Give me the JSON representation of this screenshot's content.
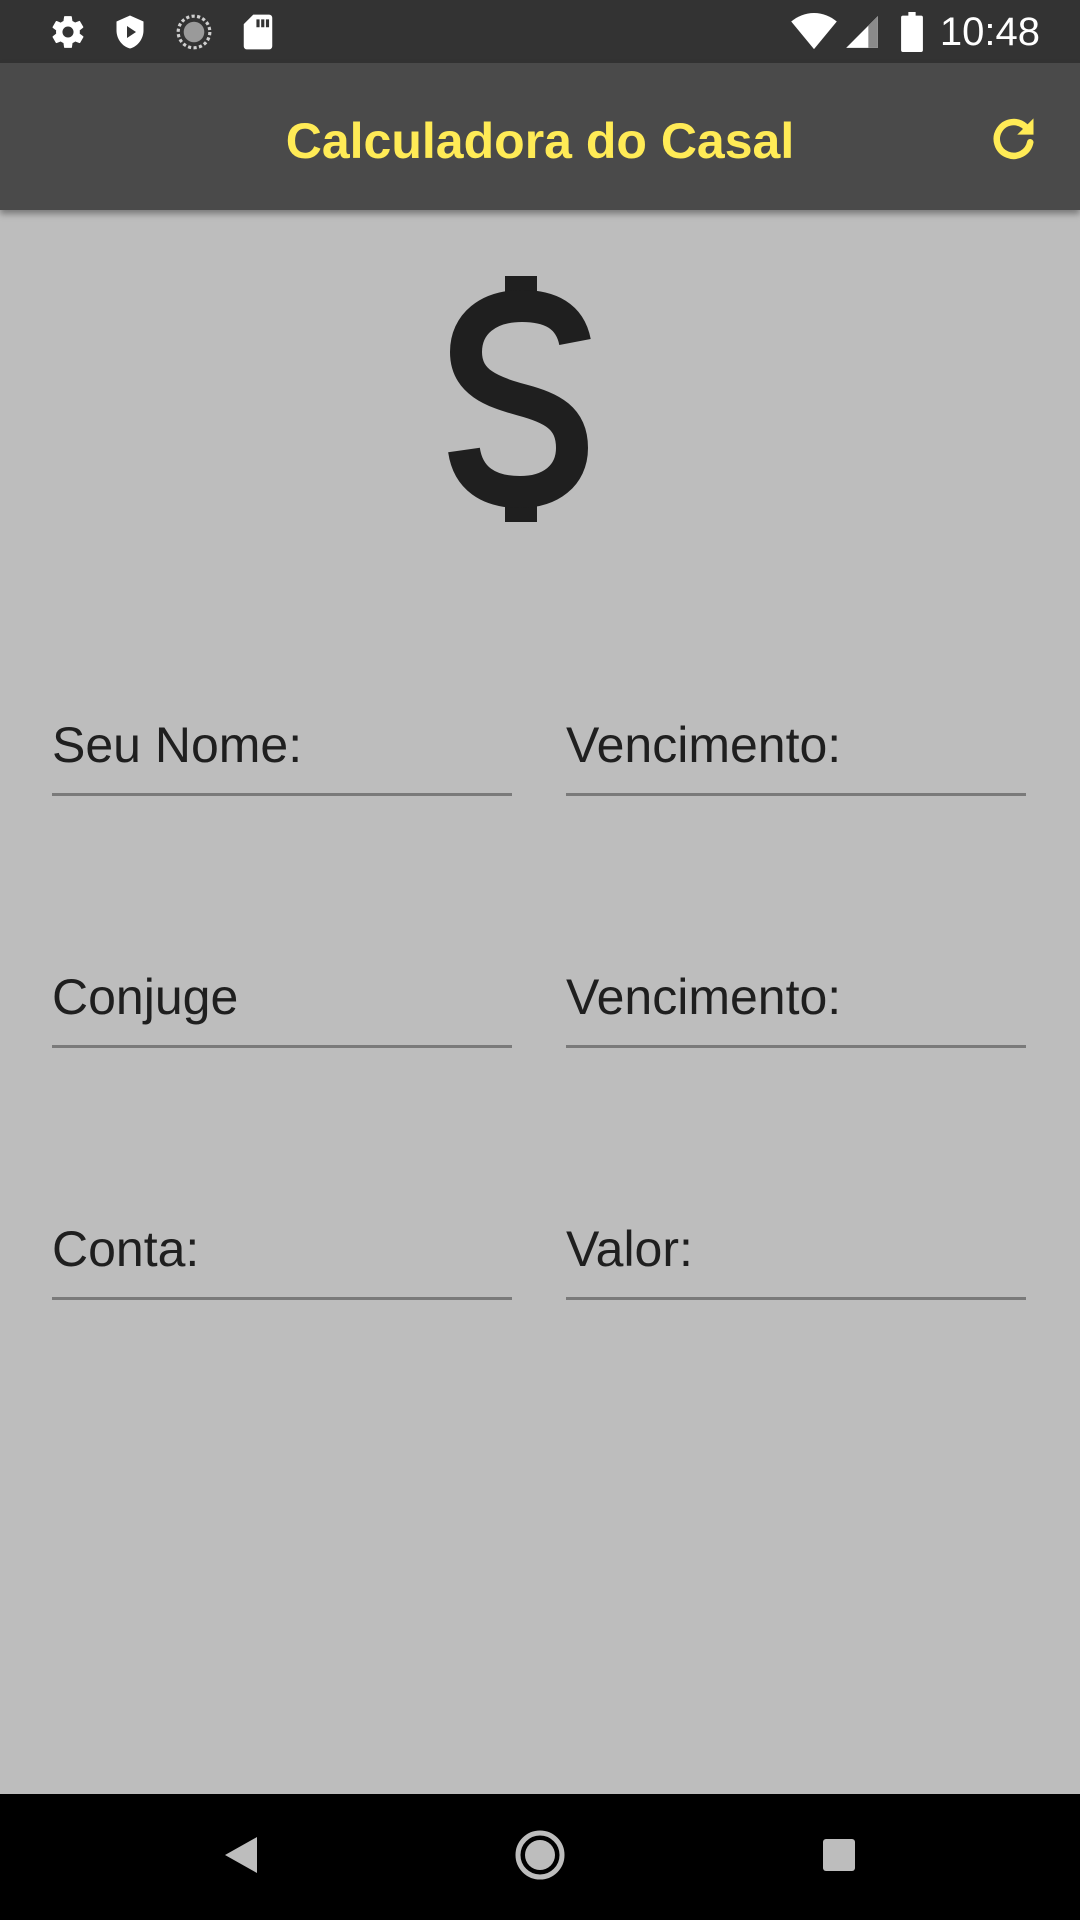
{
  "status_bar": {
    "time": "10:48",
    "left_icons": [
      "gear-icon",
      "shield-play-icon",
      "sync-circle-icon",
      "sd-card-icon"
    ],
    "right_icons": [
      "wifi-icon",
      "signal-icon",
      "battery-icon"
    ]
  },
  "app_bar": {
    "title": "Calculadora do Casal",
    "refresh_icon": "refresh-icon",
    "title_color": "#ffeb56",
    "background": "#4a4a4a"
  },
  "hero": {
    "icon": "dollar-icon"
  },
  "form": {
    "seu_nome": {
      "placeholder": "Seu Nome:",
      "value": ""
    },
    "vencimento_1": {
      "placeholder": "Vencimento:",
      "value": ""
    },
    "conjuge": {
      "placeholder": "Conjuge",
      "value": ""
    },
    "vencimento_2": {
      "placeholder": "Vencimento:",
      "value": ""
    },
    "conta": {
      "placeholder": "Conta:",
      "value": ""
    },
    "valor": {
      "placeholder": "Valor:",
      "value": ""
    }
  },
  "nav_bar": {
    "icons": [
      "back-icon",
      "home-icon",
      "recents-icon"
    ]
  }
}
